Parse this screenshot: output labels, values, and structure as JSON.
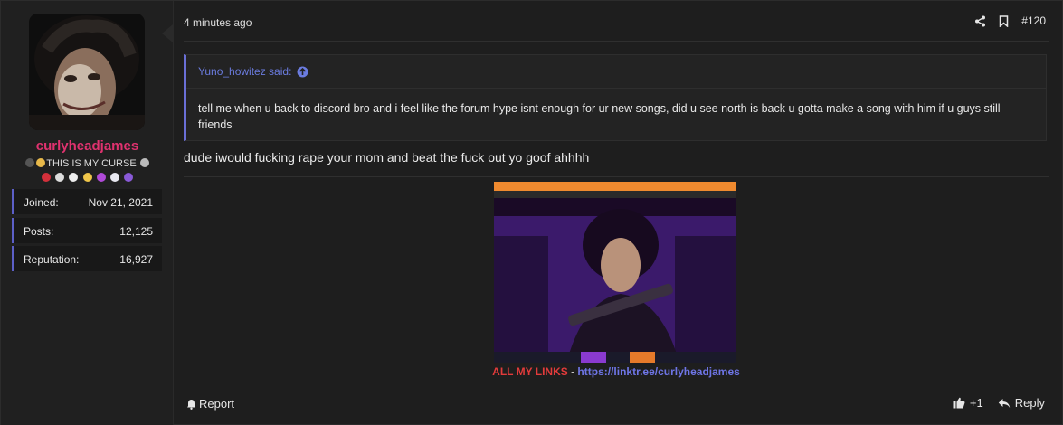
{
  "post": {
    "timestamp": "4 minutes ago",
    "number": "#120",
    "message": "dude iwould fucking rape your mom and beat the fuck out yo goof ahhhh"
  },
  "user": {
    "name": "curlyheadjames",
    "title": "THIS IS MY CURSE",
    "stats": [
      {
        "label": "Joined:",
        "value": "Nov 21, 2021"
      },
      {
        "label": "Posts:",
        "value": "12,125"
      },
      {
        "label": "Reputation:",
        "value": "16,927"
      }
    ]
  },
  "quote": {
    "author": "Yuno_howitez said:",
    "text": "tell me when u back to discord bro and i feel like the forum hype isnt enough for ur new songs, did u see north is back u gotta make a song with him if u guys still friends"
  },
  "signature": {
    "links_label": "ALL MY LINKS",
    "separator": "-",
    "url": "https://linktr.ee/curlyheadjames"
  },
  "footer": {
    "report": "Report",
    "like_count": "+1",
    "reply": "Reply"
  },
  "colors": {
    "username": "#e0326f",
    "accent": "#5c5fc7",
    "link": "#6e75e6",
    "links_label": "#e23b3b"
  },
  "icons": [
    "share-icon",
    "bookmark-icon",
    "arrow-up-circle-icon",
    "bell-icon",
    "thumbs-up-icon",
    "reply-icon"
  ]
}
